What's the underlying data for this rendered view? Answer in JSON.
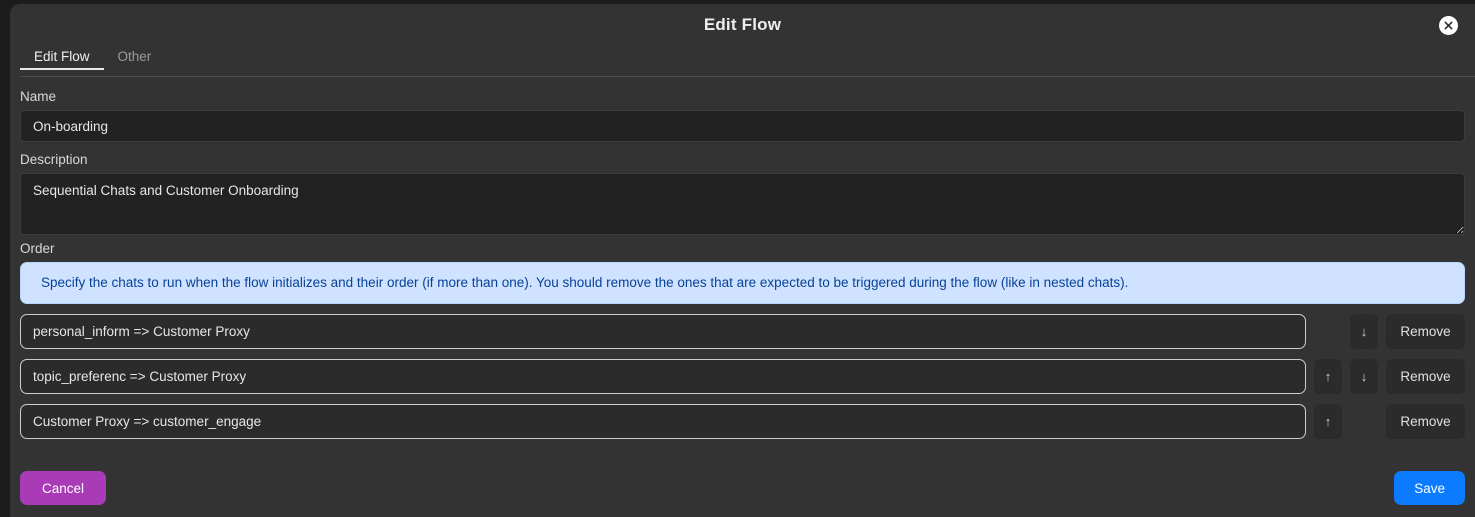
{
  "modal": {
    "title": "Edit Flow",
    "close_icon": "close-circle-icon"
  },
  "tabs": [
    {
      "label": "Edit Flow",
      "active": true
    },
    {
      "label": "Other",
      "active": false
    }
  ],
  "form": {
    "name": {
      "label": "Name",
      "value": "On-boarding",
      "placeholder": ""
    },
    "description": {
      "label": "Description",
      "value": "Sequential Chats and Customer Onboarding",
      "placeholder": ""
    },
    "order": {
      "label": "Order",
      "alert": "Specify the chats to run when the flow initializes and their order (if more than one). You should remove the ones that are expected to be triggered during the flow (like in nested chats).",
      "remove_label": "Remove",
      "up_icon": "arrow-up-icon",
      "down_icon": "arrow-down-icon",
      "up_glyph": "↑",
      "down_glyph": "↓",
      "rows": [
        {
          "value": "personal_inform => Customer Proxy",
          "has_up": false,
          "has_down": true
        },
        {
          "value": "topic_preferenc => Customer Proxy",
          "has_up": true,
          "has_down": true
        },
        {
          "value": "Customer Proxy => customer_engage",
          "has_up": true,
          "has_down": false
        }
      ]
    }
  },
  "footer": {
    "cancel_label": "Cancel",
    "save_label": "Save"
  },
  "colors": {
    "modal_bg": "#333333",
    "input_bg": "#222222",
    "alert_bg": "#cfe2ff",
    "alert_text": "#084298",
    "cancel": "#a93bb7",
    "save": "#0d7bff"
  }
}
